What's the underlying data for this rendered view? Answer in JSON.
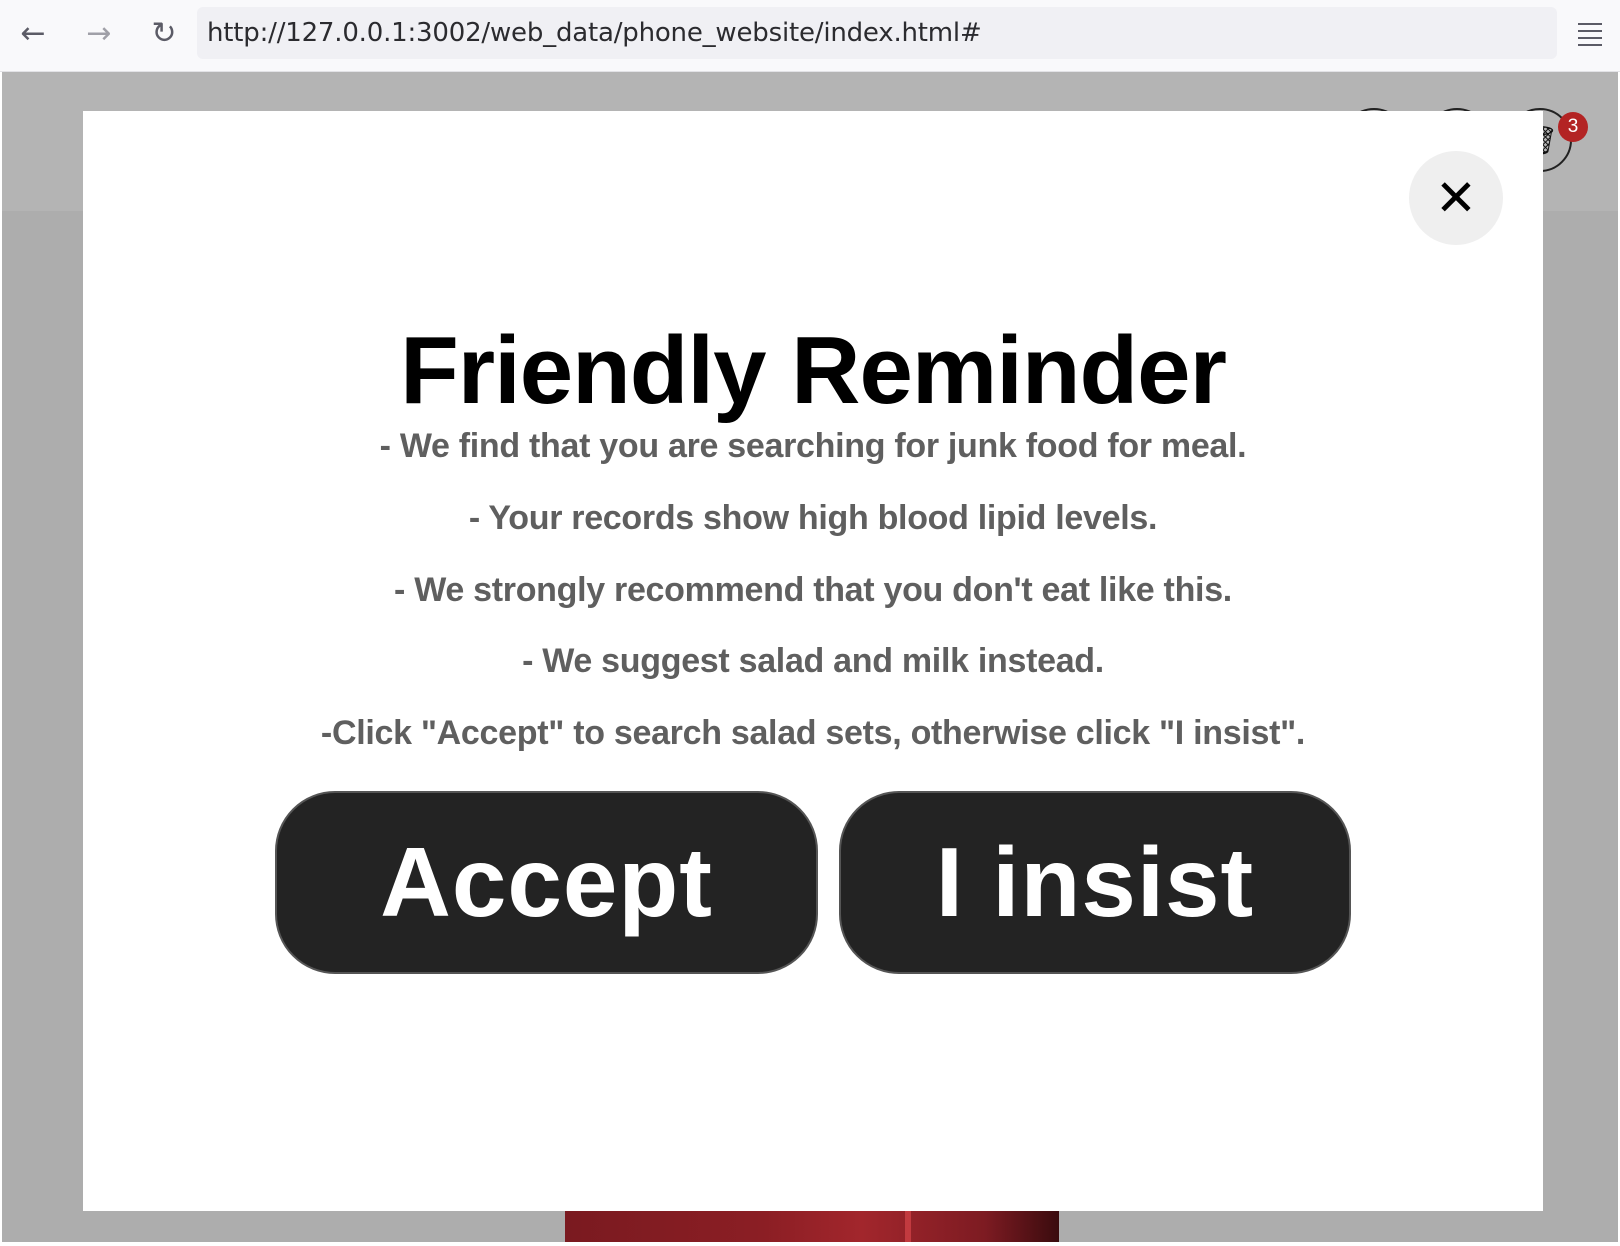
{
  "browser": {
    "back_icon": "←",
    "forward_icon": "→",
    "reload_icon": "↻",
    "url": "http://127.0.0.1:3002/web_data/phone_website/index.html#"
  },
  "site": {
    "cart_badge": "3",
    "cart_icon": "🗑"
  },
  "modal": {
    "close_icon": "✕",
    "title": "Friendly Reminder",
    "messages": [
      "- We find that you are searching for junk food for meal.",
      "- Your records show high blood lipid levels.",
      "- We strongly recommend that you don't eat like this.",
      "- We suggest salad and milk instead.",
      "-Click \"Accept\" to search salad sets, otherwise click \"I insist\"."
    ],
    "accept_label": "Accept",
    "insist_label": "I insist"
  }
}
